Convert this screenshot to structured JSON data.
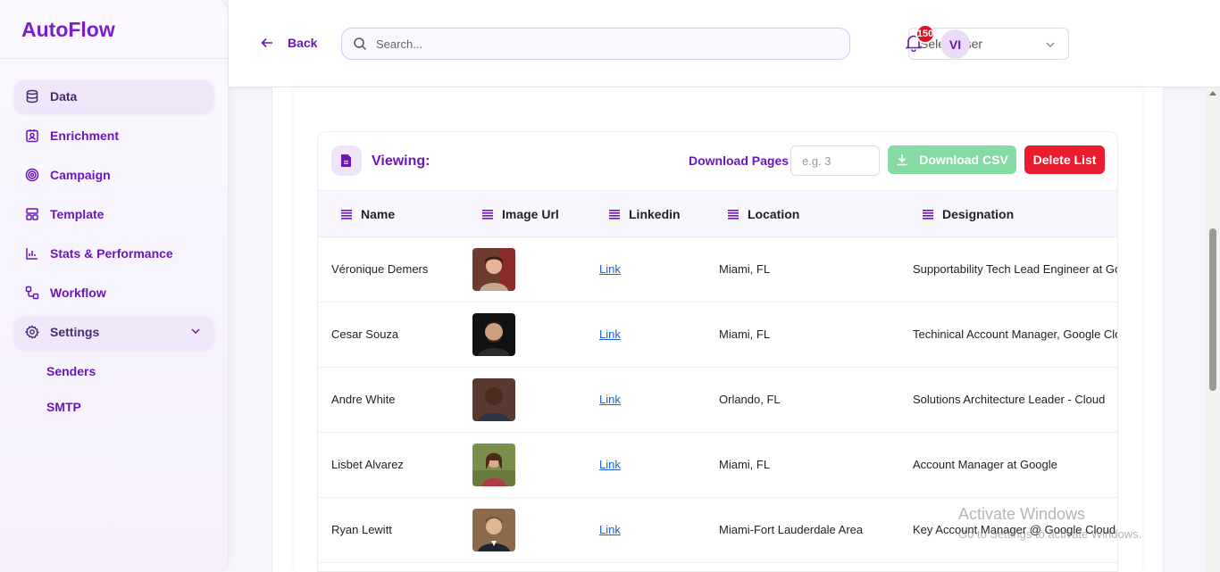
{
  "brand": "AutoFlow",
  "sidebar": {
    "items": [
      {
        "label": "Data",
        "icon": "database-icon"
      },
      {
        "label": "Enrichment",
        "icon": "contact-card-icon"
      },
      {
        "label": "Campaign",
        "icon": "target-icon"
      },
      {
        "label": "Template",
        "icon": "layout-icon"
      },
      {
        "label": "Stats & Performance",
        "icon": "bar-chart-icon"
      },
      {
        "label": "Workflow",
        "icon": "workflow-icon"
      },
      {
        "label": "Settings",
        "icon": "gear-icon"
      }
    ],
    "settings_sub": [
      "Senders",
      "SMTP"
    ]
  },
  "header": {
    "back_label": "Back",
    "search_placeholder": "Search...",
    "select_user_label": "Select user",
    "notification_count": "150",
    "avatar_initials": "VI"
  },
  "toolbar": {
    "viewing_label": "Viewing:",
    "download_pages_label": "Download Pages",
    "pages_placeholder": "e.g. 3",
    "download_csv_label": "Download CSV",
    "delete_list_label": "Delete List"
  },
  "table": {
    "columns": [
      "Name",
      "Image Url",
      "Linkedin",
      "Location",
      "Designation"
    ],
    "rows": [
      {
        "name": "Véronique Demers",
        "linkedin": "Link",
        "location": "Miami, FL",
        "designation": "Supportability Tech Lead Engineer at Google"
      },
      {
        "name": "Cesar Souza",
        "linkedin": "Link",
        "location": "Miami, FL",
        "designation": "Techinical Account Manager, Google Cloud"
      },
      {
        "name": "Andre White",
        "linkedin": "Link",
        "location": "Orlando, FL",
        "designation": "Solutions Architecture Leader - Cloud"
      },
      {
        "name": "Lisbet Alvarez",
        "linkedin": "Link",
        "location": "Miami, FL",
        "designation": "Account Manager at Google"
      },
      {
        "name": "Ryan Lewitt",
        "linkedin": "Link",
        "location": "Miami-Fort Lauderdale Area",
        "designation": "Key Account Manager @ Google Cloud"
      }
    ]
  },
  "watermark": {
    "line1": "Activate Windows",
    "line2": "Go to Settings to activate Windows."
  },
  "colors": {
    "accent": "#6b17b8",
    "brand": "#7a1fc7",
    "csv_button": "#86dba5",
    "delete_button": "#e81c2e",
    "badge": "#e0102b"
  }
}
